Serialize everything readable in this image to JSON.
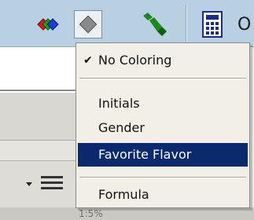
{
  "toolbar": {
    "calc_label": "O"
  },
  "menu": {
    "items": [
      {
        "label": "No Coloring",
        "checked": true
      },
      {
        "label": "Initials"
      },
      {
        "label": "Gender"
      },
      {
        "label": "Favorite Flavor",
        "highlighted": true
      },
      {
        "label": "Formula"
      }
    ]
  },
  "background": {
    "bottom_text": "1:5%"
  },
  "colors": {
    "highlight": "#0b2a6e",
    "menu_bg": "#f1efe6",
    "toolbar_bg": "#b9cfe2"
  }
}
